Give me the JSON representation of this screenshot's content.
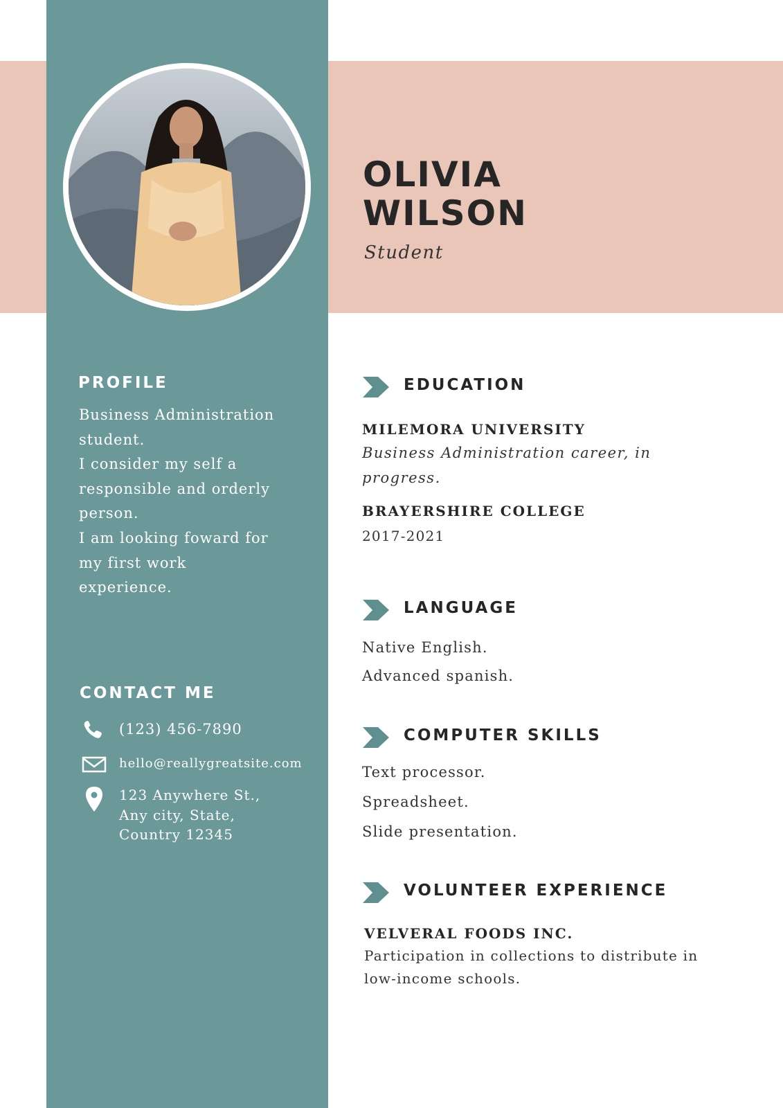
{
  "name": {
    "first": "OLIVIA",
    "last": "WILSON"
  },
  "role": "Student",
  "photo": {
    "alt": "Portrait photo",
    "icon": "portrait-photo"
  },
  "profile": {
    "heading": "PROFILE",
    "lines": [
      "Business Administration",
      "student.",
      "I consider my self a",
      "responsible and orderly",
      "person.",
      "I am looking foward for",
      "my first work",
      "experience."
    ]
  },
  "contact": {
    "heading": "CONTACT ME",
    "phone": "(123) 456-7890",
    "email": "hello@reallygreatsite.com",
    "address": [
      "123 Anywhere St.,",
      "Any city, State,",
      "Country 12345"
    ]
  },
  "education": {
    "heading": "EDUCATION",
    "entries": [
      {
        "title": "MILEMORA UNIVERSITY",
        "lines": [
          "Business Administration career, in",
          "progress."
        ]
      },
      {
        "title": "BRAYERSHIRE COLLEGE",
        "lines": [
          "2017-2021"
        ]
      }
    ]
  },
  "language": {
    "heading": "LANGUAGE",
    "items": [
      "Native English.",
      "Advanced spanish."
    ]
  },
  "computer_skills": {
    "heading": "COMPUTER SKILLS",
    "items": [
      "Text processor.",
      "Spreadsheet.",
      "Slide presentation."
    ]
  },
  "volunteer": {
    "heading": "VOLUNTEER EXPERIENCE",
    "title": "VELVERAL FOODS INC.",
    "lines": [
      "Participation in collections to distribute in",
      "low-income schools."
    ]
  },
  "colors": {
    "sidebar": "#6b9898",
    "band": "#e9c6b8",
    "accent": "#5f8f8f",
    "text": "#262626"
  }
}
